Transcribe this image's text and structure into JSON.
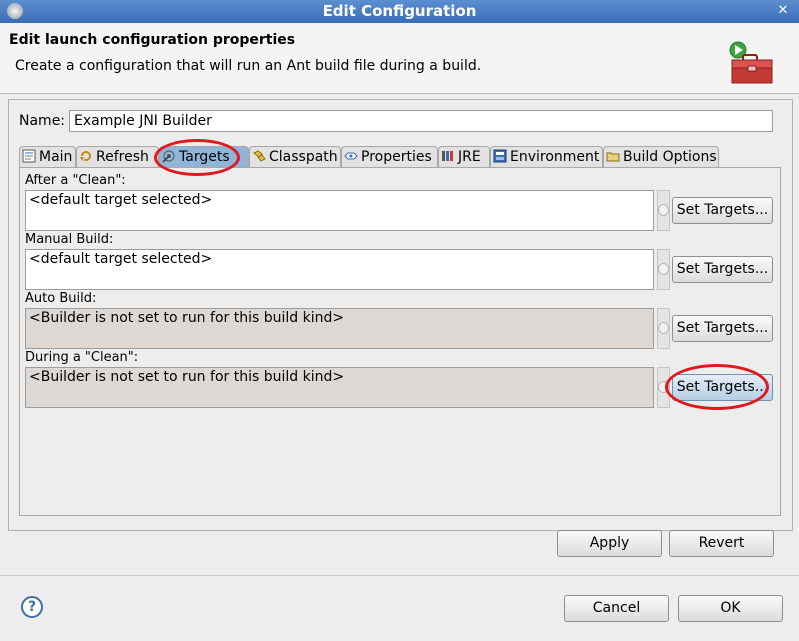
{
  "window": {
    "title": "Edit Configuration",
    "close_glyph": "✕"
  },
  "header": {
    "title": "Edit launch configuration properties",
    "description": "Create a configuration that will run an Ant build file during a build."
  },
  "name_field": {
    "label": "Name:",
    "value": "Example JNI Builder"
  },
  "tabs": [
    {
      "label": "Main",
      "icon": "main-tab-icon"
    },
    {
      "label": "Refresh",
      "icon": "refresh-icon"
    },
    {
      "label": "Targets",
      "icon": "targets-icon",
      "active": true
    },
    {
      "label": "Classpath",
      "icon": "classpath-icon"
    },
    {
      "label": "Properties",
      "icon": "properties-icon"
    },
    {
      "label": "JRE",
      "icon": "jre-icon"
    },
    {
      "label": "Environment",
      "icon": "environment-icon"
    },
    {
      "label": "Build Options",
      "icon": "build-options-icon"
    }
  ],
  "sections": [
    {
      "label": "After a \"Clean\":",
      "value": "<default target selected>",
      "button": "Set Targets..."
    },
    {
      "label": "Manual Build:",
      "value": "<default target selected>",
      "button": "Set Targets..."
    },
    {
      "label": "Auto Build:",
      "value": "<Builder is not set to run for this build kind>",
      "button": "Set Targets..."
    },
    {
      "label": "During a \"Clean\":",
      "value": "<Builder is not set to run for this build kind>",
      "button": "Set Targets..."
    }
  ],
  "buttons": {
    "apply": "Apply",
    "revert": "Revert",
    "cancel": "Cancel",
    "ok": "OK",
    "help": "?"
  },
  "colors": {
    "titlebar": "#3b6db5",
    "highlight": "#e0191e",
    "active_tab": "#8fb5d9"
  }
}
